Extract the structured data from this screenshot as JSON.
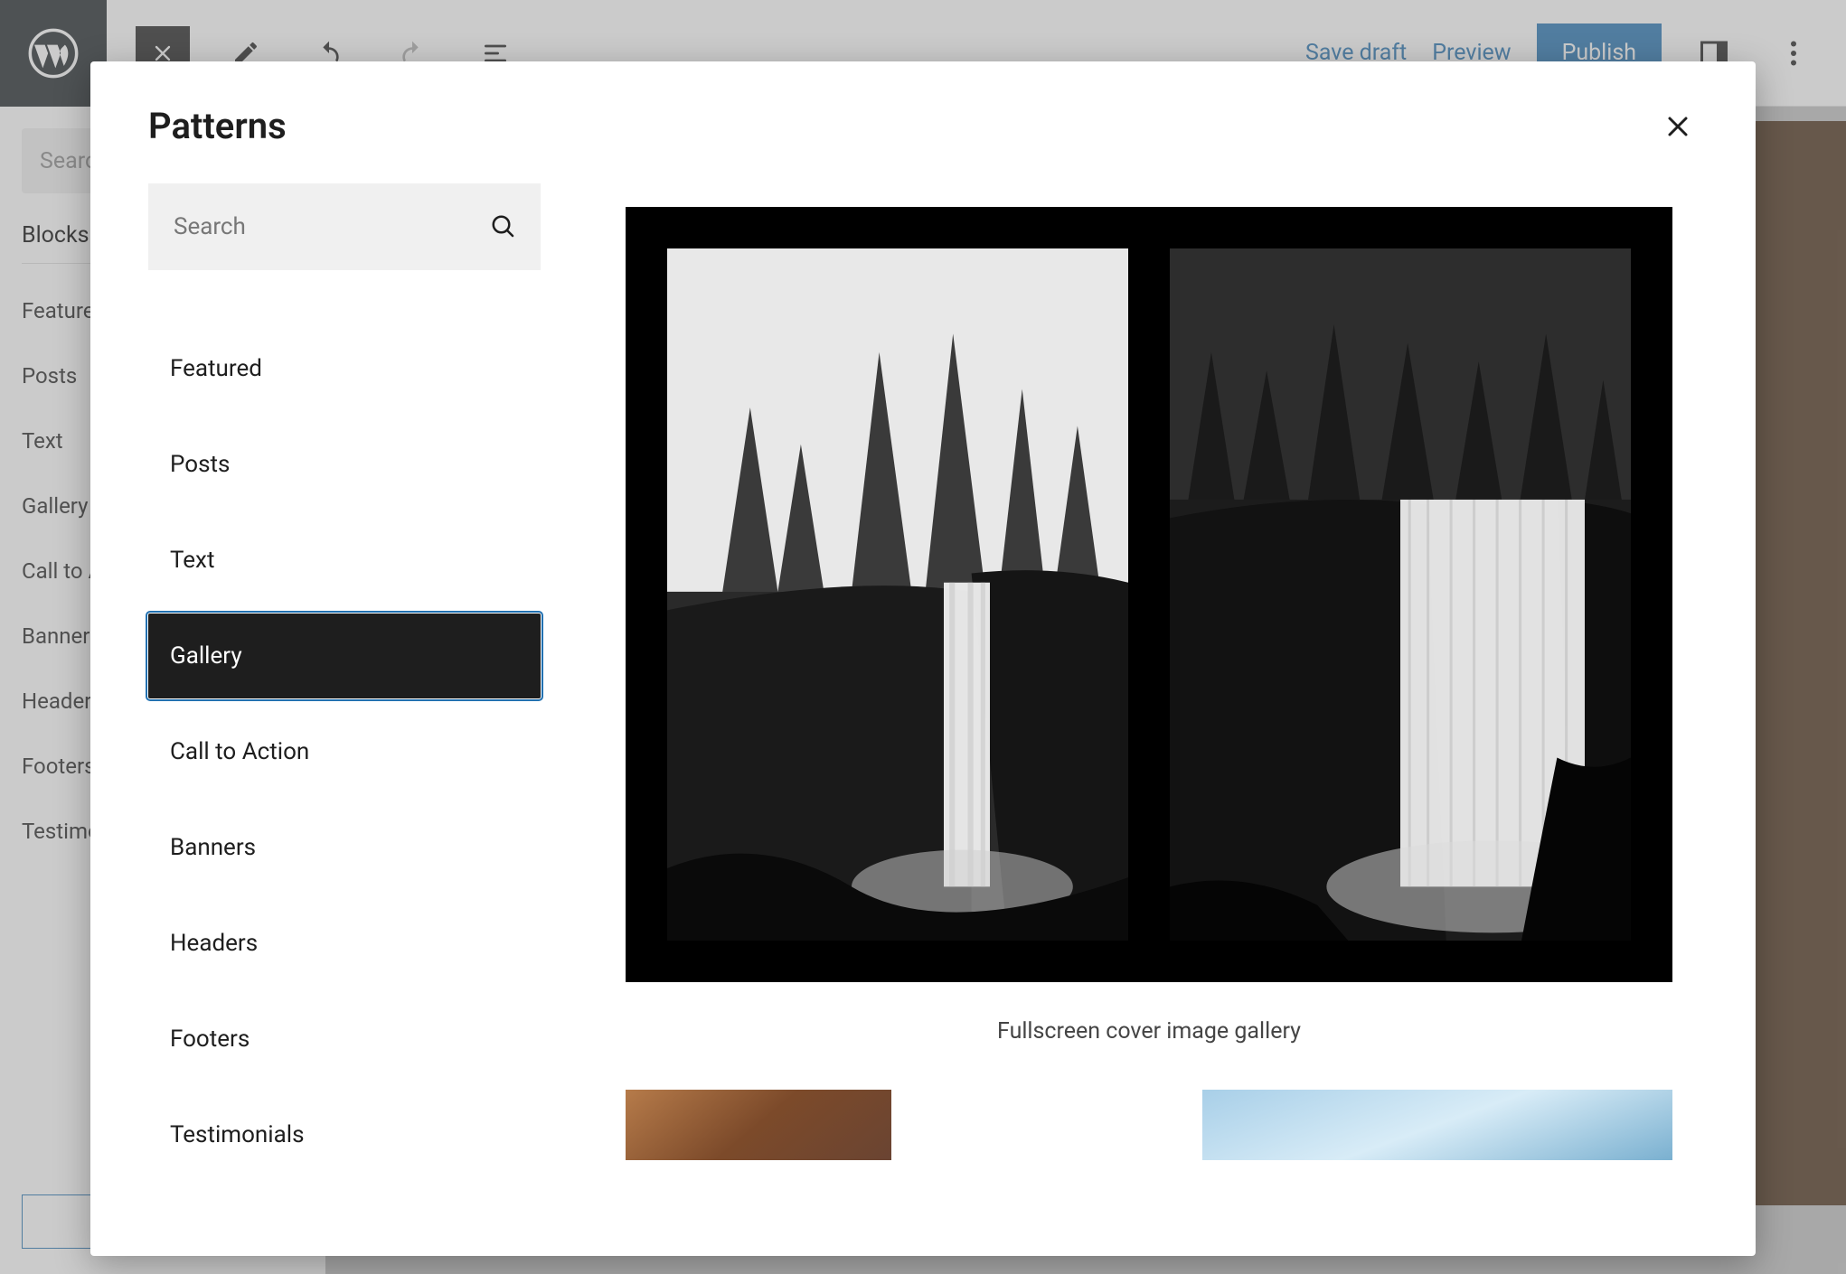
{
  "editor": {
    "toolbar": {
      "save_draft": "Save draft",
      "preview": "Preview",
      "publish": "Publish"
    }
  },
  "bg_sidebar": {
    "search_placeholder": "Search",
    "tab_label": "Blocks",
    "categories": [
      "Featured",
      "Posts",
      "Text",
      "Gallery",
      "Call to Action",
      "Banners",
      "Headers",
      "Footers",
      "Testimonials"
    ]
  },
  "modal": {
    "title": "Patterns",
    "search_placeholder": "Search",
    "categories": [
      {
        "label": "Featured",
        "active": false
      },
      {
        "label": "Posts",
        "active": false
      },
      {
        "label": "Text",
        "active": false
      },
      {
        "label": "Gallery",
        "active": true
      },
      {
        "label": "Call to Action",
        "active": false
      },
      {
        "label": "Banners",
        "active": false
      },
      {
        "label": "Headers",
        "active": false
      },
      {
        "label": "Footers",
        "active": false
      },
      {
        "label": "Testimonials",
        "active": false
      }
    ],
    "patterns": [
      {
        "label": "Fullscreen cover image gallery"
      }
    ]
  },
  "colors": {
    "accent": "#2271b1",
    "dark": "#1e1e1e"
  }
}
